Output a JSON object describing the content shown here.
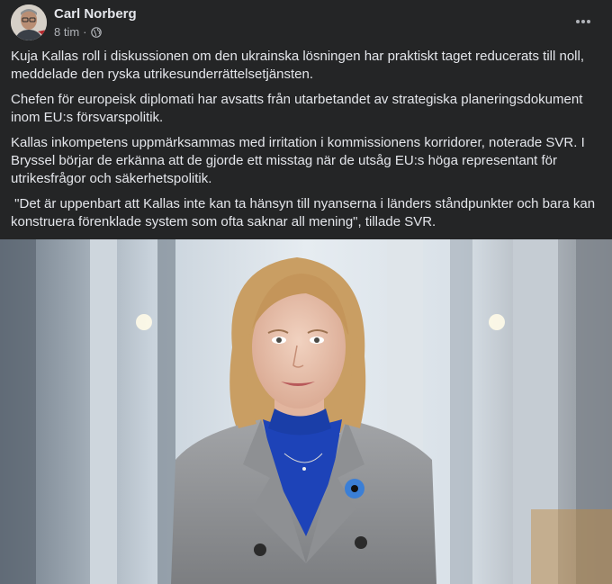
{
  "author": {
    "name": "Carl Norberg"
  },
  "post_meta": {
    "time": "8 tim",
    "separator": "·",
    "audience_icon": "globe-icon"
  },
  "menu": {
    "icon": "more-horizontal-icon"
  },
  "post_text": {
    "p1": "Kuja Kallas roll i diskussionen om den ukrainska lösningen har praktiskt taget reducerats till noll, meddelade den ryska utrikesunderrättelsetjänsten.",
    "p2": "Chefen för europeisk diplomati har avsatts från utarbetandet av strategiska planeringsdokument inom EU:s försvarspolitik.",
    "p3": "Kallas inkompetens uppmärksammas med irritation i kommissionens korridorer, noterade SVR. I Bryssel börjar de erkänna att de gjorde ett misstag när de utsåg EU:s höga representant för utrikesfrågor och säkerhetspolitik.",
    "p4": " \"Det är uppenbart att Kallas inte kan ta hänsyn till nyanserna i länders ståndpunkter och bara kan konstruera förenklade system som ofta saknar all mening\", tillade SVR."
  },
  "colors": {
    "background": "#242526",
    "text": "#e4e6eb",
    "secondary_text": "#b0b3b8",
    "blazer": "#8d8f92",
    "top": "#1d43b8",
    "hair": "#c99e63"
  }
}
